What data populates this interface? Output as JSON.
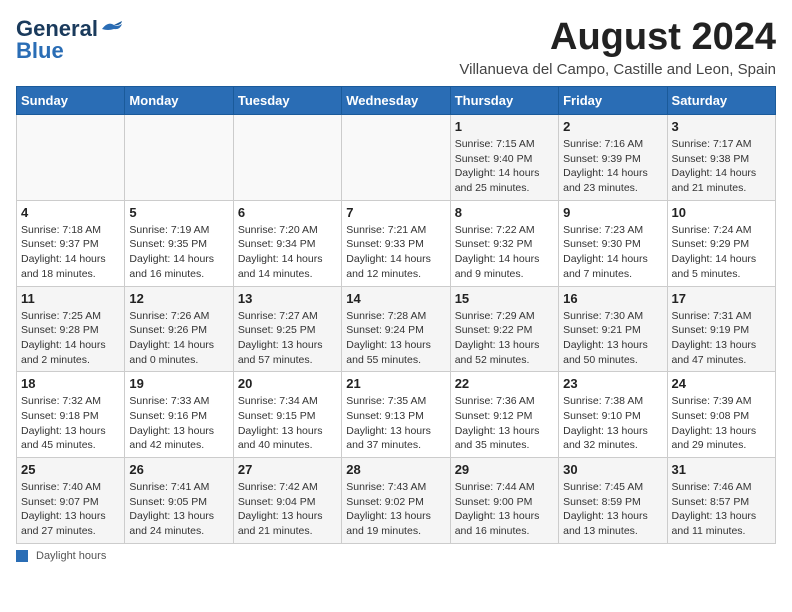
{
  "header": {
    "logo_line1": "General",
    "logo_line2": "Blue",
    "month_year": "August 2024",
    "subtitle": "Villanueva del Campo, Castille and Leon, Spain"
  },
  "weekdays": [
    "Sunday",
    "Monday",
    "Tuesday",
    "Wednesday",
    "Thursday",
    "Friday",
    "Saturday"
  ],
  "weeks": [
    [
      {
        "day": "",
        "info": ""
      },
      {
        "day": "",
        "info": ""
      },
      {
        "day": "",
        "info": ""
      },
      {
        "day": "",
        "info": ""
      },
      {
        "day": "1",
        "info": "Sunrise: 7:15 AM\nSunset: 9:40 PM\nDaylight: 14 hours and 25 minutes."
      },
      {
        "day": "2",
        "info": "Sunrise: 7:16 AM\nSunset: 9:39 PM\nDaylight: 14 hours and 23 minutes."
      },
      {
        "day": "3",
        "info": "Sunrise: 7:17 AM\nSunset: 9:38 PM\nDaylight: 14 hours and 21 minutes."
      }
    ],
    [
      {
        "day": "4",
        "info": "Sunrise: 7:18 AM\nSunset: 9:37 PM\nDaylight: 14 hours and 18 minutes."
      },
      {
        "day": "5",
        "info": "Sunrise: 7:19 AM\nSunset: 9:35 PM\nDaylight: 14 hours and 16 minutes."
      },
      {
        "day": "6",
        "info": "Sunrise: 7:20 AM\nSunset: 9:34 PM\nDaylight: 14 hours and 14 minutes."
      },
      {
        "day": "7",
        "info": "Sunrise: 7:21 AM\nSunset: 9:33 PM\nDaylight: 14 hours and 12 minutes."
      },
      {
        "day": "8",
        "info": "Sunrise: 7:22 AM\nSunset: 9:32 PM\nDaylight: 14 hours and 9 minutes."
      },
      {
        "day": "9",
        "info": "Sunrise: 7:23 AM\nSunset: 9:30 PM\nDaylight: 14 hours and 7 minutes."
      },
      {
        "day": "10",
        "info": "Sunrise: 7:24 AM\nSunset: 9:29 PM\nDaylight: 14 hours and 5 minutes."
      }
    ],
    [
      {
        "day": "11",
        "info": "Sunrise: 7:25 AM\nSunset: 9:28 PM\nDaylight: 14 hours and 2 minutes."
      },
      {
        "day": "12",
        "info": "Sunrise: 7:26 AM\nSunset: 9:26 PM\nDaylight: 14 hours and 0 minutes."
      },
      {
        "day": "13",
        "info": "Sunrise: 7:27 AM\nSunset: 9:25 PM\nDaylight: 13 hours and 57 minutes."
      },
      {
        "day": "14",
        "info": "Sunrise: 7:28 AM\nSunset: 9:24 PM\nDaylight: 13 hours and 55 minutes."
      },
      {
        "day": "15",
        "info": "Sunrise: 7:29 AM\nSunset: 9:22 PM\nDaylight: 13 hours and 52 minutes."
      },
      {
        "day": "16",
        "info": "Sunrise: 7:30 AM\nSunset: 9:21 PM\nDaylight: 13 hours and 50 minutes."
      },
      {
        "day": "17",
        "info": "Sunrise: 7:31 AM\nSunset: 9:19 PM\nDaylight: 13 hours and 47 minutes."
      }
    ],
    [
      {
        "day": "18",
        "info": "Sunrise: 7:32 AM\nSunset: 9:18 PM\nDaylight: 13 hours and 45 minutes."
      },
      {
        "day": "19",
        "info": "Sunrise: 7:33 AM\nSunset: 9:16 PM\nDaylight: 13 hours and 42 minutes."
      },
      {
        "day": "20",
        "info": "Sunrise: 7:34 AM\nSunset: 9:15 PM\nDaylight: 13 hours and 40 minutes."
      },
      {
        "day": "21",
        "info": "Sunrise: 7:35 AM\nSunset: 9:13 PM\nDaylight: 13 hours and 37 minutes."
      },
      {
        "day": "22",
        "info": "Sunrise: 7:36 AM\nSunset: 9:12 PM\nDaylight: 13 hours and 35 minutes."
      },
      {
        "day": "23",
        "info": "Sunrise: 7:38 AM\nSunset: 9:10 PM\nDaylight: 13 hours and 32 minutes."
      },
      {
        "day": "24",
        "info": "Sunrise: 7:39 AM\nSunset: 9:08 PM\nDaylight: 13 hours and 29 minutes."
      }
    ],
    [
      {
        "day": "25",
        "info": "Sunrise: 7:40 AM\nSunset: 9:07 PM\nDaylight: 13 hours and 27 minutes."
      },
      {
        "day": "26",
        "info": "Sunrise: 7:41 AM\nSunset: 9:05 PM\nDaylight: 13 hours and 24 minutes."
      },
      {
        "day": "27",
        "info": "Sunrise: 7:42 AM\nSunset: 9:04 PM\nDaylight: 13 hours and 21 minutes."
      },
      {
        "day": "28",
        "info": "Sunrise: 7:43 AM\nSunset: 9:02 PM\nDaylight: 13 hours and 19 minutes."
      },
      {
        "day": "29",
        "info": "Sunrise: 7:44 AM\nSunset: 9:00 PM\nDaylight: 13 hours and 16 minutes."
      },
      {
        "day": "30",
        "info": "Sunrise: 7:45 AM\nSunset: 8:59 PM\nDaylight: 13 hours and 13 minutes."
      },
      {
        "day": "31",
        "info": "Sunrise: 7:46 AM\nSunset: 8:57 PM\nDaylight: 13 hours and 11 minutes."
      }
    ]
  ],
  "footer": {
    "legend_label": "Daylight hours"
  }
}
